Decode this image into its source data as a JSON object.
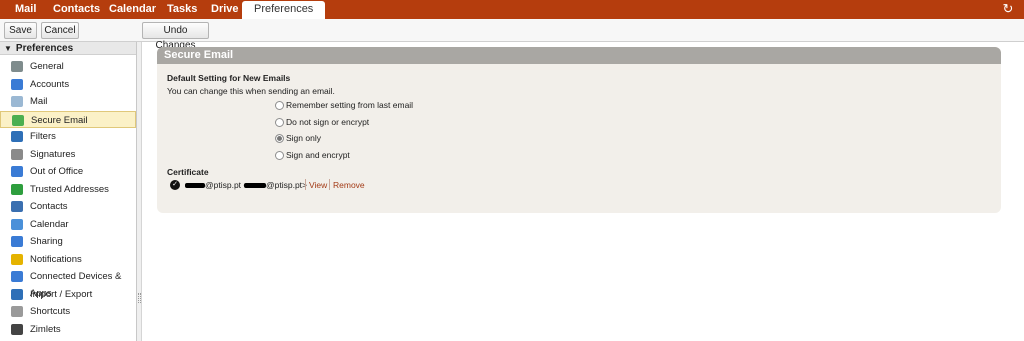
{
  "nav": {
    "tabs": [
      {
        "label": "Mail"
      },
      {
        "label": "Contacts"
      },
      {
        "label": "Calendar"
      },
      {
        "label": "Tasks"
      },
      {
        "label": "Drive"
      },
      {
        "label": "Preferences",
        "active": true
      }
    ],
    "refresh_icon": "refresh-icon"
  },
  "toolbar": {
    "save_label": "Save",
    "cancel_label": "Cancel",
    "undo_label": "Undo Changes"
  },
  "sidebar": {
    "header": "Preferences",
    "items": [
      {
        "label": "General",
        "icon": "gear-icon",
        "color": "#7f8c8d"
      },
      {
        "label": "Accounts",
        "icon": "accounts-icon",
        "color": "#3a7bd5"
      },
      {
        "label": "Mail",
        "icon": "mail-icon",
        "color": "#9bb8d3"
      },
      {
        "label": "Secure Email",
        "icon": "secure-email-icon",
        "color": "#4caf50",
        "selected": true
      },
      {
        "label": "Filters",
        "icon": "filter-icon",
        "color": "#2e6fb7"
      },
      {
        "label": "Signatures",
        "icon": "signature-icon",
        "color": "#8a8a8a"
      },
      {
        "label": "Out of Office",
        "icon": "out-of-office-icon",
        "color": "#3a7bd5"
      },
      {
        "label": "Trusted Addresses",
        "icon": "shield-icon",
        "color": "#2e9e3e"
      },
      {
        "label": "Contacts",
        "icon": "contacts-icon",
        "color": "#3a6fb0"
      },
      {
        "label": "Calendar",
        "icon": "calendar-icon",
        "color": "#4a90d9"
      },
      {
        "label": "Sharing",
        "icon": "sharing-icon",
        "color": "#3a7bd5"
      },
      {
        "label": "Notifications",
        "icon": "bell-icon",
        "color": "#e5b300"
      },
      {
        "label": "Connected Devices & Apps",
        "icon": "devices-icon",
        "color": "#3a7bd5"
      },
      {
        "label": "Import / Export",
        "icon": "import-export-icon",
        "color": "#2e6fb7"
      },
      {
        "label": "Shortcuts",
        "icon": "shortcuts-icon",
        "color": "#9a9a9a"
      },
      {
        "label": "Zimlets",
        "icon": "zimlets-icon",
        "color": "#444444"
      }
    ]
  },
  "secure_email": {
    "title": "Secure Email",
    "default_heading": "Default Setting for New Emails",
    "default_sub": "You can change this when sending an email.",
    "options": [
      {
        "label": "Remember setting from last email",
        "checked": false
      },
      {
        "label": "Do not sign or encrypt",
        "checked": false
      },
      {
        "label": "Sign only",
        "checked": true
      },
      {
        "label": "Sign and encrypt",
        "checked": false
      }
    ],
    "certificate_heading": "Certificate",
    "certificate_text_a": "@ptisp.pt <",
    "certificate_text_b": "@ptisp.pt>",
    "view_label": "View",
    "remove_label": "Remove"
  }
}
